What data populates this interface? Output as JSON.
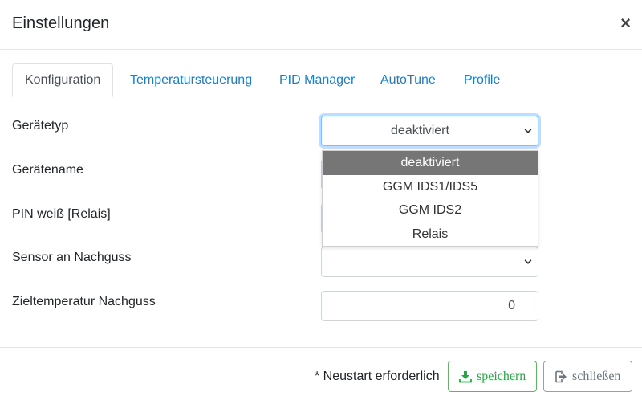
{
  "modal": {
    "title": "Einstellungen",
    "close_symbol": "×"
  },
  "tabs": [
    {
      "label": "Konfiguration",
      "active": true
    },
    {
      "label": "Temperatursteuerung",
      "active": false
    },
    {
      "label": "PID Manager",
      "active": false
    },
    {
      "label": "AutoTune",
      "active": false
    },
    {
      "label": "Profile",
      "active": false
    }
  ],
  "form": {
    "geraetetyp": {
      "label": "Gerätetyp",
      "value": "deaktiviert"
    },
    "geraetename": {
      "label": "Gerätename"
    },
    "pin": {
      "label": "PIN weiß [Relais]"
    },
    "sensor": {
      "label": "Sensor an Nachguss",
      "value": ""
    },
    "zieltemperatur": {
      "label": "Zieltemperatur Nachguss",
      "value": "0"
    }
  },
  "dropdown": {
    "options": [
      "deaktiviert",
      "GGM IDS1/IDS5",
      "GGM IDS2",
      "Relais"
    ],
    "selected": "deaktiviert"
  },
  "footer": {
    "note": "* Neustart erforderlich",
    "save_label": "speichern",
    "close_label": "schließen"
  },
  "colors": {
    "tab_link": "#1a7fc1",
    "focus_border": "#80bdff",
    "option_selected_bg": "#767676",
    "save_green": "#28a745",
    "close_gray": "#6c757d"
  },
  "icons": {
    "close": "close-icon",
    "chevron": "chevron-down-icon",
    "save": "download-icon",
    "exit": "sign-out-icon"
  }
}
